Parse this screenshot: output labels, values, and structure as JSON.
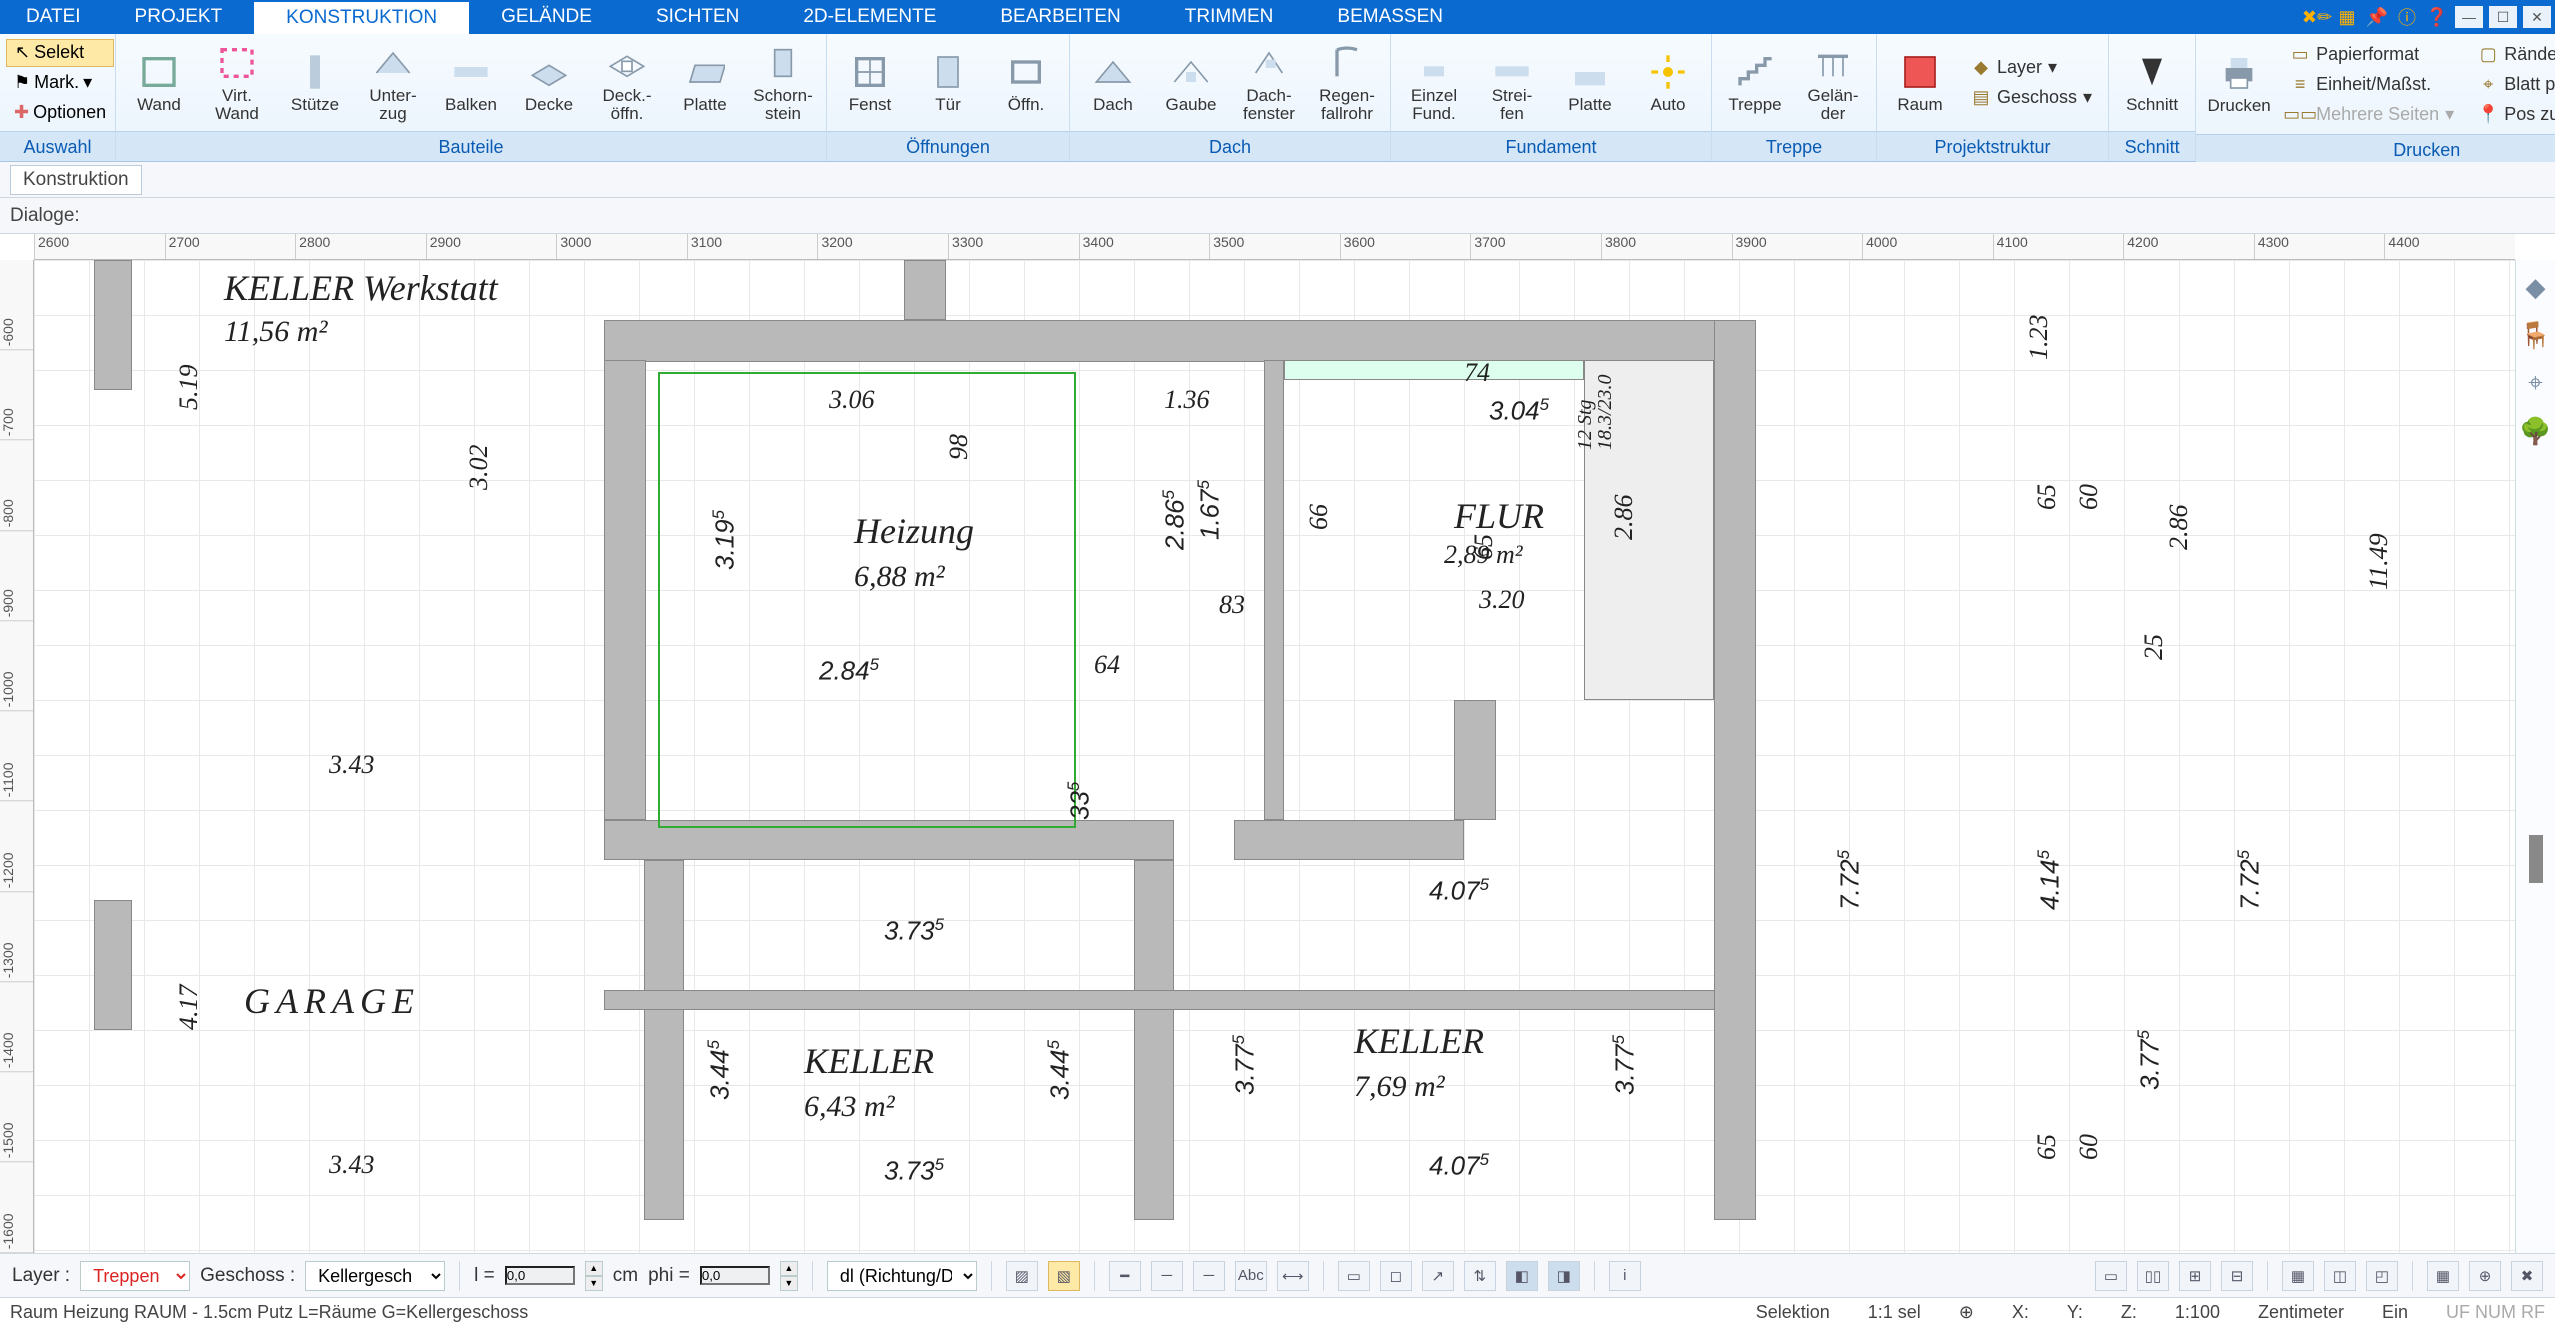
{
  "menu_tabs": {
    "datei": "DATEI",
    "projekt": "PROJEKT",
    "konstruktion": "KONSTRUKTION",
    "gelaende": "GELÄNDE",
    "sichten": "SICHTEN",
    "zdelem": "2D-ELEMENTE",
    "bearbeiten": "BEARBEITEN",
    "trimmen": "TRIMMEN",
    "bemassen": "BEMASSEN"
  },
  "ribbon": {
    "auswahl": {
      "selekt": "Selekt",
      "mark": "Mark.",
      "optionen": "Optionen",
      "caption": "Auswahl"
    },
    "bauteile": {
      "wand": "Wand",
      "virtwand": "Virt.\nWand",
      "stuetze": "Stütze",
      "unterzug": "Unter-\nzug",
      "balken": "Balken",
      "decke": "Decke",
      "deckoeffn": "Deck.-\nöffn.",
      "platte": "Platte",
      "schornstein": "Schorn-\nstein",
      "caption": "Bauteile"
    },
    "oeffnungen": {
      "fenst": "Fenst",
      "tuer": "Tür",
      "oeffn": "Öffn.",
      "caption": "Öffnungen"
    },
    "dach": {
      "dach": "Dach",
      "gaube": "Gaube",
      "dachfenster": "Dach-\nfenster",
      "regenfallrohr": "Regen-\nfallrohr",
      "caption": "Dach"
    },
    "fundament": {
      "einzel": "Einzel\nFund.",
      "streifen": "Strei-\nfen",
      "platte": "Platte",
      "auto": "Auto",
      "caption": "Fundament"
    },
    "treppe": {
      "treppe": "Treppe",
      "gelaender": "Gelän-\nder",
      "caption": "Treppe"
    },
    "projektstruktur": {
      "raum": "Raum",
      "layer": "Layer",
      "geschoss": "Geschoss",
      "caption": "Projektstruktur"
    },
    "schnitt": {
      "schnitt": "Schnitt",
      "caption": "Schnitt"
    },
    "drucken": {
      "drucken": "Drucken",
      "papierformat": "Papierformat",
      "einheit": "Einheit/Maßst.",
      "mehrere": "Mehrere Seiten",
      "raender": "Ränder einblend.",
      "blattpos": "Blatt position.",
      "poszurueck": "Pos zurücksetz.",
      "caption": "Drucken"
    }
  },
  "subbar1": {
    "label": "Konstruktion"
  },
  "subbar2": {
    "label": "Dialoge:"
  },
  "h_ruler": [
    "2600",
    "2700",
    "2800",
    "2900",
    "3000",
    "3100",
    "3200",
    "3300",
    "3400",
    "3500",
    "3600",
    "3700",
    "3800",
    "3900",
    "4000",
    "4100",
    "4200",
    "4300",
    "4400"
  ],
  "v_ruler": [
    "-600",
    "-700",
    "-800",
    "-900",
    "-1000",
    "-1100",
    "-1200",
    "-1300",
    "-1400",
    "-1500",
    "-1600"
  ],
  "rooms": {
    "werkstatt": {
      "name": "KELLER Werkstatt",
      "area": "11,56 m²"
    },
    "heizung": {
      "name": "Heizung",
      "area": "6,88 m²"
    },
    "flur": {
      "name": "FLUR",
      "area": "2,89 m²"
    },
    "garage": {
      "name": "GARAGE"
    },
    "keller1": {
      "name": "KELLER",
      "area": "6,43 m²"
    },
    "keller2": {
      "name": "KELLER",
      "area": "7,69 m²"
    }
  },
  "dims": {
    "d306": "3.06",
    "d136": "1.36",
    "d74": "74",
    "d304": "3.04",
    "d98": "98",
    "d167": "1.67",
    "d2865": "2.86",
    "d66": "66",
    "d286": "2.86",
    "d1823": "18.3/23.0",
    "d12": "12 Stg",
    "d519": "5.19",
    "d302": "3.02",
    "d3195": "3.19",
    "d65": "65",
    "d320": "3.20",
    "d83": "83",
    "d2845": "2.84",
    "d64": "64",
    "d335": "33",
    "d343": "3.43",
    "d417": "4.17",
    "d3735": "3.73",
    "d4075": "4.07",
    "d3445": "3.44",
    "d3775": "3.77",
    "d772": "7.72",
    "d4145": "4.14",
    "d123": "1.23",
    "d60": "60",
    "d25": "25",
    "d1149": "11.49",
    "d343b": "3.43",
    "d3735b": "3.73",
    "d4075b": "4.07"
  },
  "toolbar": {
    "layer_label": "Layer :",
    "layer_value": "Treppen",
    "geschoss_label": "Geschoss :",
    "geschoss_value": "Kellergesch",
    "l_label": "l =",
    "l_value": "0,0",
    "unit_cm": "cm",
    "phi_label": "phi =",
    "phi_value": "0,0",
    "direction": "dl (Richtung/Di"
  },
  "status": {
    "left": "Raum Heizung RAUM - 1.5cm Putz L=Räume G=Kellergeschoss",
    "selektion": "Selektion",
    "ratio": "1:1 sel",
    "x": "X:",
    "y": "Y:",
    "z": "Z:",
    "scale": "1:100",
    "unit": "Zentimeter",
    "ein": "Ein",
    "ufnum": "UF NUM RF"
  }
}
